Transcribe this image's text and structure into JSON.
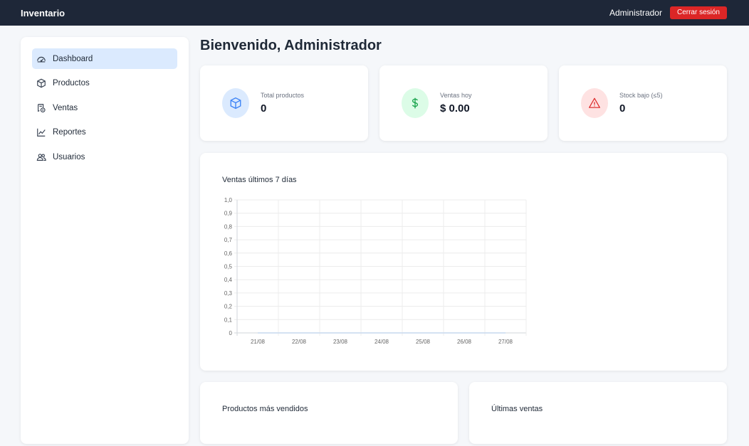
{
  "header": {
    "brand": "Inventario",
    "user": "Administrador",
    "logout_label": "Cerrar sesión"
  },
  "sidebar": {
    "items": [
      {
        "label": "Dashboard",
        "icon": "gauge-icon",
        "active": true
      },
      {
        "label": "Productos",
        "icon": "box-icon",
        "active": false
      },
      {
        "label": "Ventas",
        "icon": "receipt-icon",
        "active": false
      },
      {
        "label": "Reportes",
        "icon": "line-chart-icon",
        "active": false
      },
      {
        "label": "Usuarios",
        "icon": "users-icon",
        "active": false
      }
    ]
  },
  "main": {
    "title": "Bienvenido, Administrador",
    "stats": [
      {
        "label": "Total productos",
        "value": "0",
        "icon": "box-icon",
        "color": "#3b82f6",
        "bg": "#dbeafe"
      },
      {
        "label": "Ventas hoy",
        "value": "$ 0.00",
        "icon": "dollar-icon",
        "color": "#16a34a",
        "bg": "#dcfce7"
      },
      {
        "label": "Stock bajo (≤5)",
        "value": "0",
        "icon": "warning-icon",
        "color": "#dc2626",
        "bg": "#fee2e2"
      }
    ],
    "chart_title": "Ventas últimos 7 días",
    "top_products_title": "Productos más vendidos",
    "recent_sales_title": "Últimas ventas"
  },
  "chart_data": {
    "type": "line",
    "title": "Ventas últimos 7 días",
    "categories": [
      "21/08",
      "22/08",
      "23/08",
      "24/08",
      "25/08",
      "26/08",
      "27/08"
    ],
    "series": [
      {
        "values": [
          0,
          0,
          0,
          0,
          0,
          0,
          0
        ]
      }
    ],
    "ylim": [
      0,
      1
    ],
    "yticks": [
      "0",
      "0,1",
      "0,2",
      "0,3",
      "0,4",
      "0,5",
      "0,6",
      "0,7",
      "0,8",
      "0,9",
      "1,0"
    ],
    "grid": true
  }
}
